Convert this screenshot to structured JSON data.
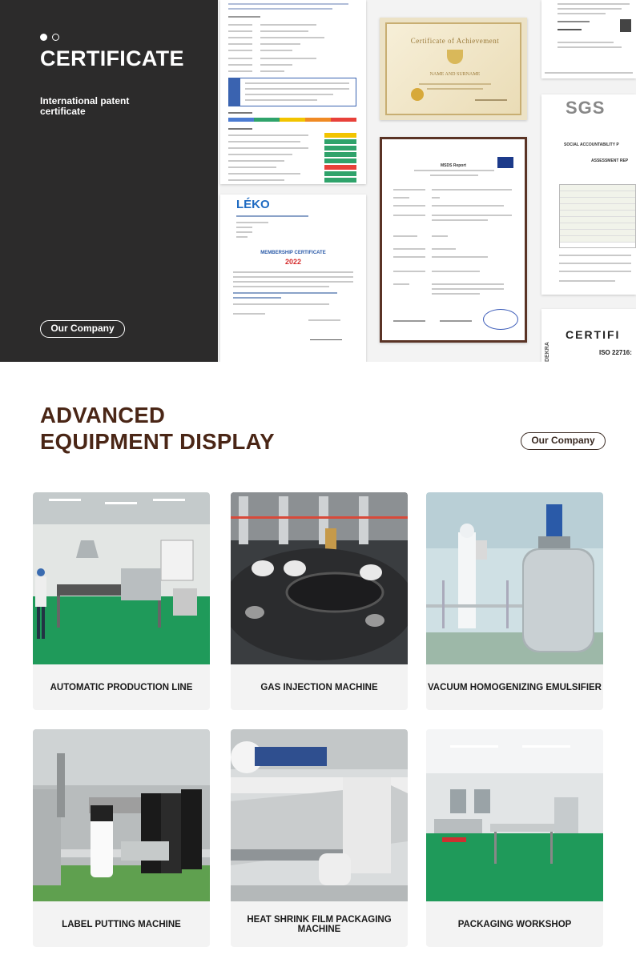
{
  "certificate": {
    "title": "CERTIFICATE",
    "subtitle": "International patent certificate",
    "button_label": "Our Company",
    "docs": {
      "gold_title": "Certificate of Achievement",
      "gold_name": "NAME AND SURNAME",
      "leko_logo": "LÉKO",
      "membership_title": "MEMBERSHIP CERTIFICATE",
      "membership_year": "2022",
      "msds_title": "MSDS Report",
      "sgs_logo": "SGS",
      "sgs_line1": "SOCIAL ACCOUNTABILITY P",
      "sgs_line2": "ASSESSMENT REP",
      "side_label": "DEKRA",
      "certif_text": "CERTIFI",
      "iso_text": "ISO 22716:"
    }
  },
  "equipment": {
    "heading_line1": "ADVANCED",
    "heading_line2": "EQUIPMENT DISPLAY",
    "button_label": "Our Company",
    "items": [
      {
        "label": "AUTOMATIC PRODUCTION LINE",
        "icon": "production-line-photo"
      },
      {
        "label": "GAS INJECTION MACHINE",
        "icon": "gas-injection-photo"
      },
      {
        "label": "VACUUM HOMOGENIZING EMULSIFIER",
        "icon": "emulsifier-photo"
      },
      {
        "label": "LABEL PUTTING MACHINE",
        "icon": "labeling-photo"
      },
      {
        "label": "HEAT SHRINK FILM PACKAGING MACHINE",
        "icon": "shrink-wrap-photo"
      },
      {
        "label": "PACKAGING WORKSHOP",
        "icon": "workshop-photo"
      }
    ]
  },
  "colors": {
    "dark_panel": "#2c2b2b",
    "heading_brown": "#4a2616",
    "card_bg": "#f3f3f3",
    "floor_green": "#1f9a5a"
  }
}
